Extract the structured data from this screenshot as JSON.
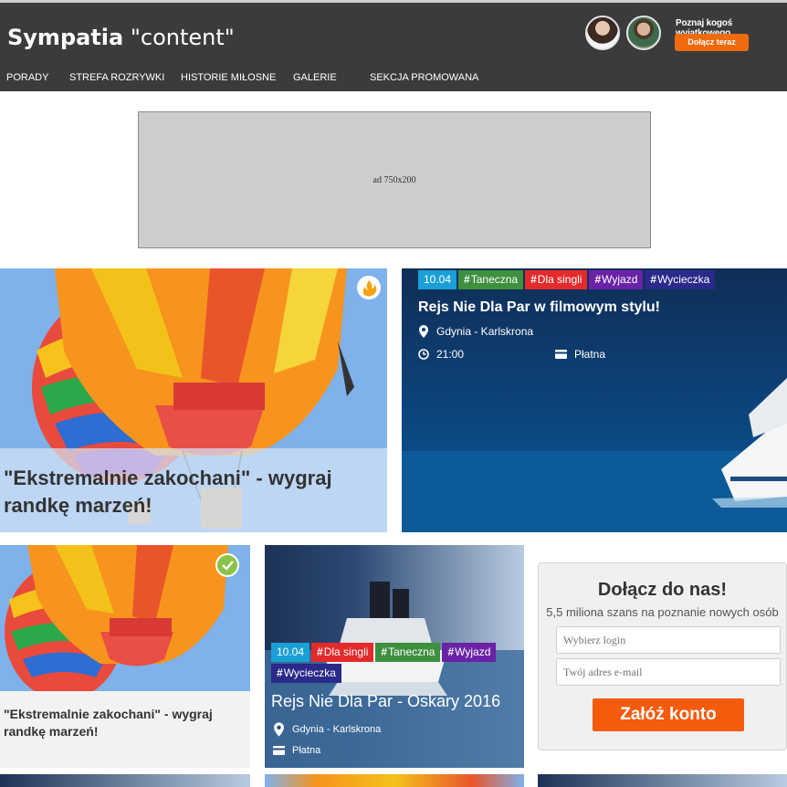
{
  "header": {
    "brand_bold": "Sympatia",
    "brand_rest": "\"content\"",
    "promo_text": "Poznaj kogoś wyjątkowego",
    "join_button": "Dołącz teraz",
    "nav": [
      "PORADY",
      "STREFA ROZRYWKI",
      "HISTORIE MIŁOSNE",
      "GALERIE",
      "SEKCJA PROMOWANA"
    ]
  },
  "ad": {
    "label": "ad 750x200"
  },
  "tiles": {
    "feature_main": {
      "title": "\"Ekstremalnie zakochani\" - wygraj randkę marzeń!"
    },
    "event_main": {
      "tags": [
        {
          "text": "10.04",
          "hash": false,
          "color": "#1aa0d6"
        },
        {
          "text": "Taneczna",
          "hash": true,
          "color": "#3e8f3e"
        },
        {
          "text": "Dla singli",
          "hash": true,
          "color": "#e32b2b"
        },
        {
          "text": "Wyjazd",
          "hash": true,
          "color": "#6a22a7"
        },
        {
          "text": "Wycieczka",
          "hash": true,
          "color": "#2a2a8a"
        }
      ],
      "title": "Rejs Nie Dla Par w filmowym stylu!",
      "location": "Gdynia - Karlskrona",
      "time": "21:00",
      "price": "Płatna"
    },
    "feature_small": {
      "title": "\"Ekstremalnie zakochani\" - wygraj randkę marzeń!"
    },
    "event_small": {
      "tags_row1": [
        {
          "text": "10.04",
          "hash": false,
          "color": "#1aa0d6"
        },
        {
          "text": "Dla singli",
          "hash": true,
          "color": "#e32b2b"
        },
        {
          "text": "Taneczna",
          "hash": true,
          "color": "#3e8f3e"
        },
        {
          "text": "Wyjazd",
          "hash": true,
          "color": "#6a22a7"
        }
      ],
      "tags_row2": [
        {
          "text": "Wycieczka",
          "hash": true,
          "color": "#2a2a8a"
        }
      ],
      "title": "Rejs Nie Dla Par - Oskary 2016",
      "location": "Gdynia - Karlskrona",
      "price": "Płatna"
    }
  },
  "signup": {
    "title": "Dołącz do nas!",
    "subtitle": "5,5 miliona szans na poznanie nowych osób",
    "login_placeholder": "Wybierz login",
    "email_placeholder": "Twój adres e-mail",
    "button": "Załóż konto"
  },
  "colors": {
    "header_bg": "#3b3b3b",
    "accent_orange": "#f06a0e",
    "signup_button": "#f55b0c"
  },
  "icons": [
    "location-pin-icon",
    "clock-icon",
    "card-icon",
    "flame-badge-icon",
    "check-badge-icon"
  ]
}
